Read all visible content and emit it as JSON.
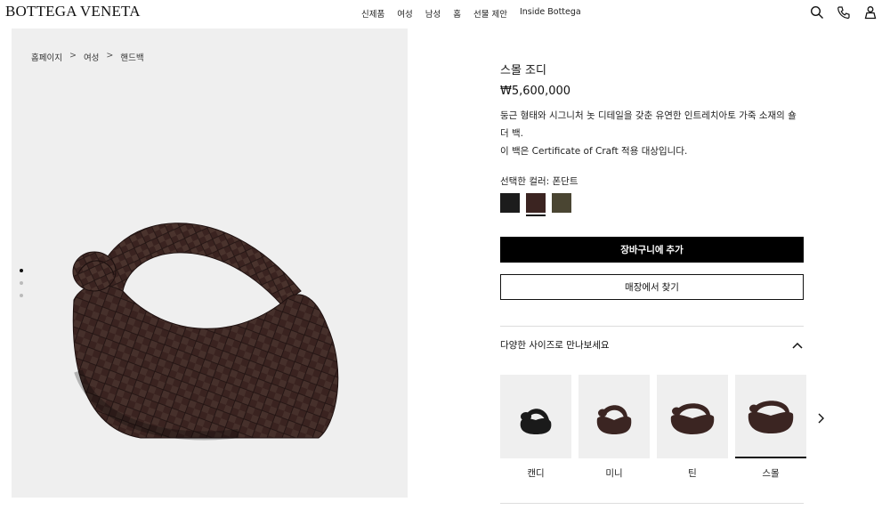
{
  "header": {
    "logo": "BOTTEGA VENETA",
    "nav": [
      "신제품",
      "여성",
      "남성",
      "홈",
      "선물 제안",
      "Inside Bottega"
    ],
    "icons": [
      "search-icon",
      "phone-icon",
      "account-icon"
    ]
  },
  "breadcrumb": [
    "홈페이지",
    "여성",
    "핸드백"
  ],
  "breadcrumb_sep": ">",
  "gallery": {
    "slides": 3,
    "active_slide": 1
  },
  "product": {
    "title": "스몰 조디",
    "price": "₩5,600,000",
    "description_1": "둥근 형태와 시그니처 놋 디테일을 갖춘 유연한 인트레치아토 가죽 소재의 숄더 백.",
    "description_2": "이 백은 Certificate of Craft 적용 대상입니다.",
    "color_label": "선택한 컬러: 폰단트",
    "swatches": [
      {
        "color": "#1c1c1c",
        "selected": false
      },
      {
        "color": "#3b2421",
        "selected": true
      },
      {
        "color": "#4a4532",
        "selected": false
      }
    ],
    "add_to_cart": "장바구니에 추가",
    "find_in_store": "매장에서 찾기"
  },
  "sizes": {
    "header": "다양한 사이즈로 만나보세요",
    "items": [
      {
        "label": "캔디",
        "color": "#1a1a1a",
        "selected": false
      },
      {
        "label": "미니",
        "color": "#3b2522",
        "selected": false
      },
      {
        "label": "틴",
        "color": "#3b2522",
        "selected": false
      },
      {
        "label": "스몰",
        "color": "#3b2522",
        "selected": true
      }
    ]
  },
  "colors": {
    "accent": "#000000",
    "bag": "#3a2320",
    "gallery_bg": "#efefef"
  }
}
